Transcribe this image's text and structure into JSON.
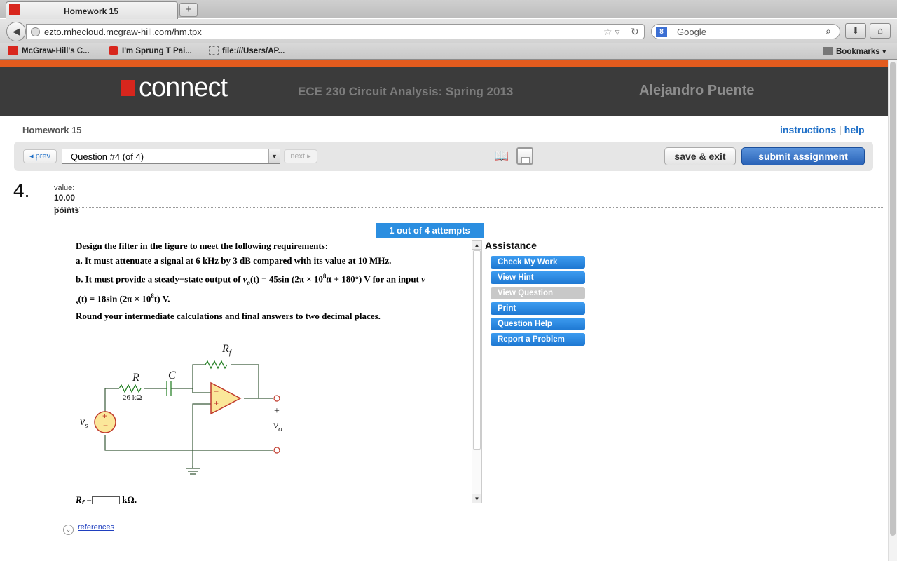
{
  "browser": {
    "tab_title": "Homework 15",
    "new_tab": "+",
    "url": "ezto.mhecloud.mcgraw-hill.com/hm.tpx",
    "search_engine": "Google",
    "bookmarks": [
      "McGraw-Hill's C...",
      "I'm Sprung T Pai...",
      "file:///Users/AP..."
    ],
    "bookmarks_menu": "Bookmarks"
  },
  "header": {
    "logo_text": "connect",
    "course": "ECE 230 Circuit Analysis: Spring 2013",
    "user": "Alejandro Puente",
    "accent": "#e35b1e"
  },
  "page": {
    "title": "Homework 15",
    "instructions": "instructions",
    "help": "help",
    "sep": "|"
  },
  "toolbar": {
    "prev": "◂ prev",
    "question_select": "Question #4 (of 4)",
    "next": "next ▸",
    "save_exit": "save & exit",
    "submit": "submit assignment"
  },
  "question": {
    "number": "4.",
    "value_label": "value:",
    "value": "10.00",
    "points": "points",
    "attempts": "1 out of 4 attempts",
    "line1": "Design the filter in the figure to meet the following requirements:",
    "line2": "a. It must attenuate a signal at 6 kHz by 3 dB compared with its value at 10 MHz.",
    "line3a": "b. It must provide a steady−state output of ",
    "v": "v",
    "sub_o": "o",
    "line3b": "(t) = 45sin (2π × 10",
    "exp8": "8",
    "line3c": "t + 180°) V for an input ",
    "sub_s": "s",
    "line4a": "(t) = 18sin (2π × 10",
    "line4b": "t) V.",
    "line5": "Round your intermediate calculations and final answers to two decimal places.",
    "answer_label": "R",
    "answer_sub": "f",
    "answer_eq": " =",
    "answer_unit": " kΩ."
  },
  "circuit": {
    "rf": "R",
    "rf_sub": "f",
    "r": "R",
    "c": "C",
    "r_value": "26 kΩ",
    "vs": "v",
    "vs_sub": "s",
    "vo": "v",
    "vo_sub": "o",
    "plus": "+",
    "minus": "−",
    "opamp_minus": "−",
    "opamp_plus": "+"
  },
  "assistance": {
    "title": "Assistance",
    "buttons": [
      "Check My Work",
      "View Hint",
      "View Question",
      "Print",
      "Question Help",
      "Report a Problem"
    ]
  },
  "references": "references"
}
